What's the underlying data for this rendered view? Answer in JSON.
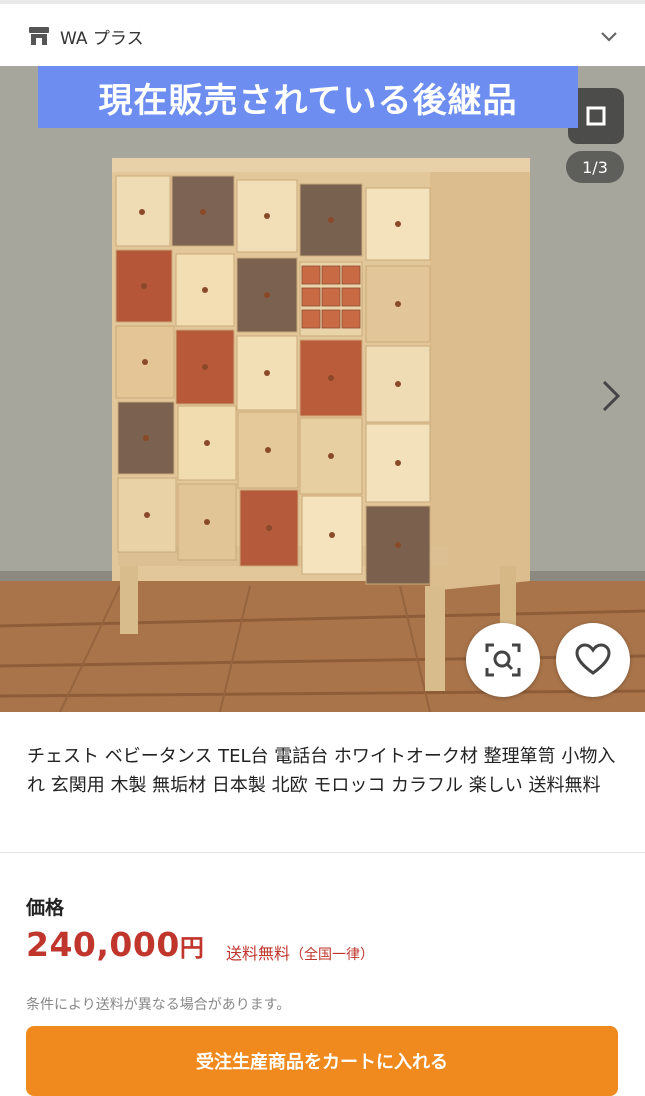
{
  "shop": {
    "name": "WA プラス"
  },
  "gallery": {
    "banner_text": "現在販売されている後継品",
    "counter": "1/3"
  },
  "product": {
    "title": "チェスト ベビータンス TEL台 電話台 ホワイトオーク材 整理箪笥 小物入れ 玄関用 木製 無垢材 日本製 北欧 モロッコ カラフル 楽しい 送料無料"
  },
  "pricing": {
    "label": "価格",
    "amount": "240,000",
    "currency": "円",
    "shipping": "送料無料",
    "shipping_note": "（全国一律）",
    "condition_note": "条件により送料が異なる場合があります。"
  },
  "actions": {
    "cart_button": "受注生産商品をカートに入れる"
  },
  "colors": {
    "accent_price": "#c0362c",
    "cart_button": "#f08a1f",
    "banner": "#6d8ef0"
  },
  "icons": [
    "shop-icon",
    "chevron-down-icon",
    "chevron-right-icon",
    "image-search-icon",
    "heart-icon"
  ]
}
